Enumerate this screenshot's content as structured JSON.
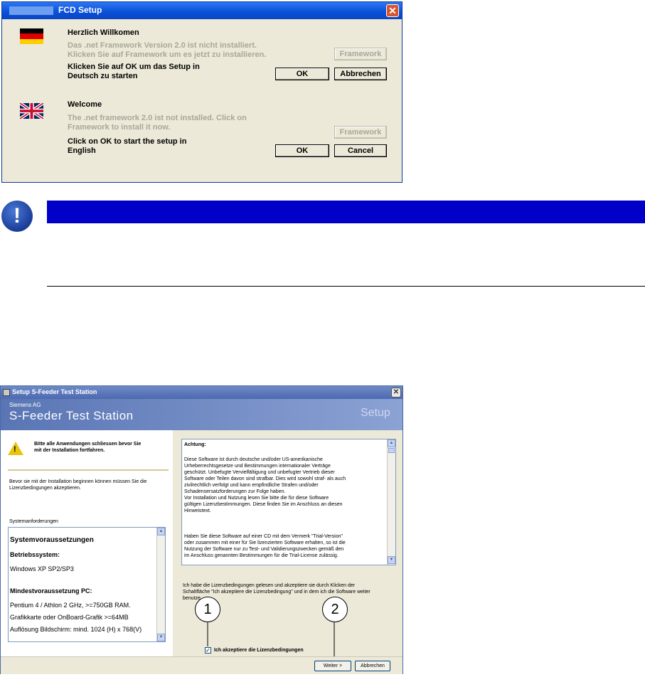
{
  "dialog1": {
    "title": "FCD Setup",
    "close": "✕",
    "german": {
      "heading": "Herzlich Willkomen",
      "info_line1": "Das .net Framework Version 2.0 ist nicht installiert.",
      "info_line2": "Klicken Sie auf Framework um es jetzt zu installieren.",
      "start_line1": "Klicken Sie auf OK um das Setup in",
      "start_line2": "Deutsch zu starten",
      "framework_button": "Framework",
      "ok_button": "OK",
      "cancel_button": "Abbrechen"
    },
    "english": {
      "heading": "Welcome",
      "info_line1": "The .net framework 2.0 ist not installed. Click on",
      "info_line2": "Framework to install it now.",
      "start_line1": "Click on OK to start the setup in",
      "start_line2": "English",
      "framework_button": "Framework",
      "ok_button": "OK",
      "cancel_button": "Cancel"
    }
  },
  "note": {
    "icon": "!"
  },
  "dialog2": {
    "title": "Setup S-Feeder Test Station",
    "close": "✕",
    "company": "Siemens AG",
    "product": "S-Feeder Test Station",
    "setup_label": "Setup",
    "warning_line1": "Bitte alle Anwendungen schliessen bevor Sie",
    "warning_line2": "mit der Installation fortfahren.",
    "intro_line1": "Bevor sie mit der Installation beginnen können müssen Sie die",
    "intro_line2": "Lizenzbedingungen akzeptieren.",
    "sysreq_caption": "Systemanforderungen",
    "sysreq": {
      "heading": "Systemvoraussetzungen",
      "os_label": "Betriebssystem:",
      "os_value": "Windows XP SP2/SP3",
      "pc_label": "Mindestvoraussetzung PC:",
      "line1": "Pentium 4 / Athlon 2 GHz, >=750GB RAM.",
      "line2": "Grafikkarte oder OnBoard-Grafik >=64MB",
      "line3": "Auflösung Bildschirm: mind. 1024 (H) x 768(V)"
    },
    "license": {
      "heading": "Achtung:",
      "p1": [
        "Diese Software ist durch deutsche und/oder US-amerikanische",
        "Urheberrechtsgesetze und Bestimmungen internationaler Verträge",
        "geschützt. Unbefugte Vervielfältigung und unbefugter Vertrieb dieser",
        "Software oder Teilen davon sind strafbar. Dies wird sowohl straf- als auch",
        "zivilrechtlich verfolgt und kann empfindliche Strafen und/oder",
        "Schadensersatzforderungen zur Folge haben.",
        "Vor Installation und Nutzung lesen Sie bitte die für diese Software",
        "gültigen Lizenzbestimmungen. Diese finden Sie im Anschluss an diesen",
        "Hinweistext."
      ],
      "p2": [
        "Haben Sie diese Software auf einer CD mit dem Vermerk \"Trial-Version\"",
        "oder zusammen mit einer für Sie lizenzierten Software erhalten, so ist die",
        "Nutzung der Software nur zu Test- und Validierungszwecken gemäß den",
        "im Anschluss genannten Bestimmungen für die Trial-License zulässig."
      ]
    },
    "accept_line1": "Ich habe die Lizenzbedingungen gelesen und akzeptiere sie durch Klicken der",
    "accept_line2": "Schaltfläche \"Ich akzeptiere die Lizenzbedingung\" und in dem ich die Software weiter",
    "accept_line3": "benutze.",
    "checkbox_label": "Ich akzeptiere die Lizenzbedingungen",
    "checkbox_mark": "✓",
    "next_button": "Weiter >",
    "cancel_button": "Abbrechen",
    "callout1": "1",
    "callout2": "2"
  }
}
